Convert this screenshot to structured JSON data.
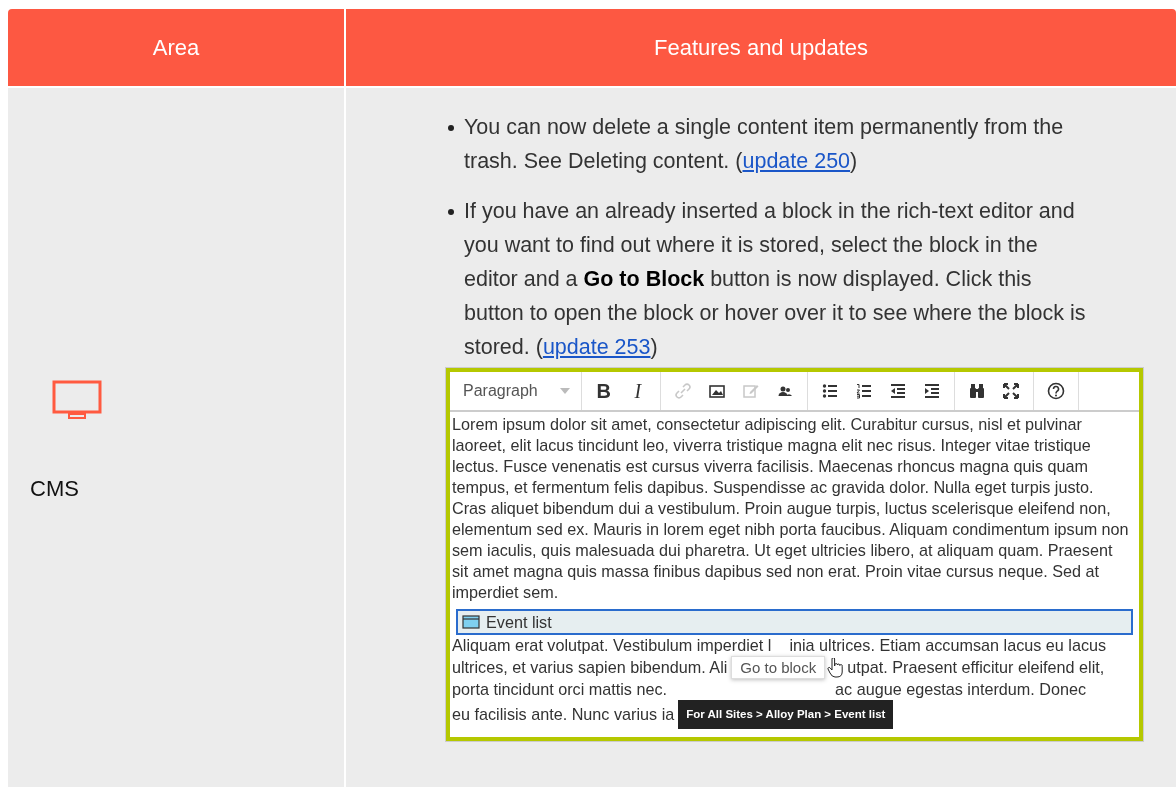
{
  "table": {
    "columns": [
      "Area",
      "Features and updates"
    ],
    "rows": [
      {
        "area": "CMS",
        "features": [
          {
            "text": "You can now delete a single content item permanently from the trash. See Deleting content. (",
            "link": "update 250",
            "after": ")"
          },
          {
            "text": "If you have an already inserted a block in the rich-text editor and you want to find out where it is stored, select the block in the editor and a **Go to Block** button is now displayed. Click this button to open the block or hover over it to see where the block is stored. (",
            "link": "update 253",
            "after": ")"
          }
        ],
        "editor": {
          "toolbar": [
            [
              {
                "kind": "dropdown",
                "label": "Paragraph",
                "disabled": false
              }
            ],
            [
              {
                "kind": "glyph-bold",
                "label": "B",
                "disabled": false
              },
              {
                "kind": "glyph-italic",
                "label": "I",
                "disabled": false
              }
            ],
            [
              {
                "kind": "link",
                "disabled": true
              },
              {
                "kind": "image",
                "disabled": false
              },
              {
                "kind": "edit",
                "disabled": true
              },
              {
                "kind": "people",
                "disabled": false
              }
            ],
            [
              {
                "kind": "bullets",
                "disabled": false
              },
              {
                "kind": "numbers",
                "disabled": false
              },
              {
                "kind": "outdent",
                "disabled": false
              },
              {
                "kind": "indent",
                "disabled": false
              }
            ],
            [
              {
                "kind": "binoculars",
                "disabled": false
              },
              {
                "kind": "fullscreen",
                "disabled": false
              }
            ],
            [
              {
                "kind": "help",
                "disabled": false
              }
            ]
          ],
          "paragraph": "Lorem ipsum dolor sit amet, consectetur adipiscing elit. Curabitur cursus, nisl et pulvinar laoreet, elit lacus tincidunt leo, viverra tristique magna elit nec risus. Integer vitae tristique lectus. Fusce venenatis est cursus viverra facilisis. Maecenas rhoncus magna quis quam tempus, et fermentum felis dapibus. Suspendisse ac gravida dolor. Nulla eget turpis justo. Cras aliquet bibendum dui a vestibulum. Proin augue turpis, luctus scelerisque eleifend non, elementum sed ex. Mauris in lorem eget nibh porta faucibus. Aliquam condimentum ipsum non sem iaculis, quis malesuada dui pharetra. Ut eget ultricies libero, at aliquam quam. Praesent sit amet magna quis massa finibus dapibus sed non erat. Proin vitae cursus neque. Sed at imperdiet sem.",
          "block": {
            "label": "Event list",
            "selected": true
          },
          "lines_after": [
            [
              "Aliquam erat volutpat. Vestibulum imperdiet l",
              "inia ultrices. Etiam accumsan lacus eu lacus"
            ],
            [
              "ultrices, et varius sapien bibendum. Ali",
              "utpat. Praesent efficitur eleifend elit,"
            ],
            [
              "porta tincidunt orci mattis nec.",
              "ac augue egestas interdum. Donec"
            ],
            [
              "eu facilisis ante. Nunc varius ia"
            ]
          ],
          "popup_button": "Go to block",
          "tooltip": "For All Sites > Alloy Plan > Event list"
        }
      }
    ]
  }
}
